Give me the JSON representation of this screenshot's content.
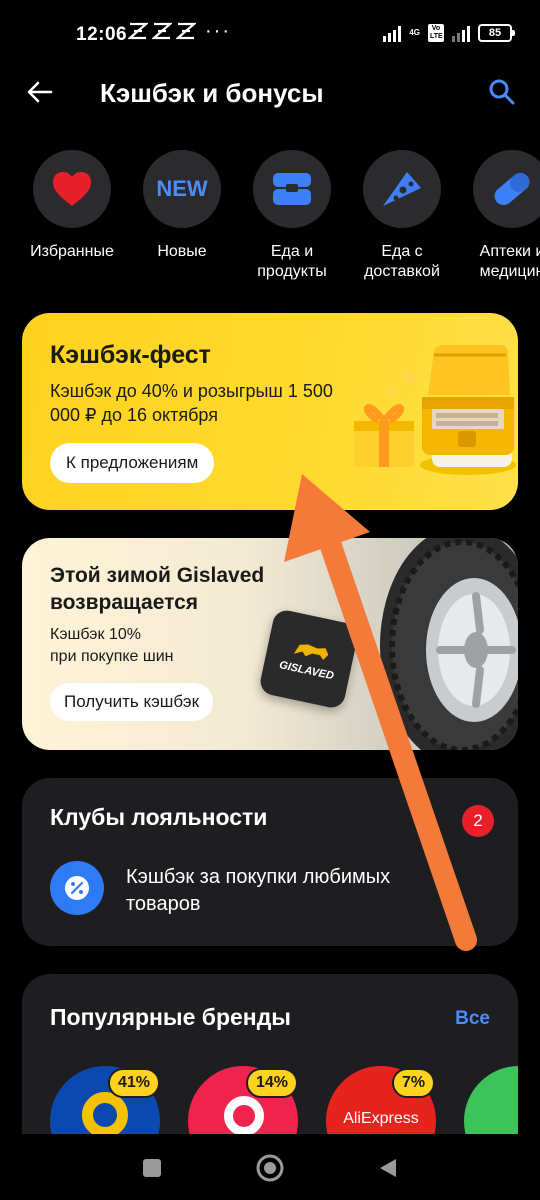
{
  "status": {
    "time": "12:06",
    "network": "4G",
    "volte": "Vo LTE",
    "battery": "85"
  },
  "header": {
    "title": "Кэшбэк и бонусы",
    "back_icon": "arrow-left-icon",
    "search_icon": "search-icon"
  },
  "categories": [
    {
      "label": "Избранные",
      "icon": "heart-icon",
      "color": "#e8202a"
    },
    {
      "label": "Новые",
      "icon": "new-icon",
      "badge_text": "NEW",
      "color": "#4a8cff"
    },
    {
      "label": "Еда и\nпродукты",
      "icon": "food-box-icon",
      "color": "#3d7ff7"
    },
    {
      "label": "Еда с\nдоставкой",
      "icon": "pizza-icon",
      "color": "#3d7ff7"
    },
    {
      "label": "Аптеки и\nмедицин",
      "icon": "pill-icon",
      "color": "#3d7ff7"
    }
  ],
  "promo_fest": {
    "title": "Кэшбэк-фест",
    "subtitle": "Кэшбэк до 40% и розыгрыш 1 500 000 ₽ до 16 октября",
    "button": "К предложениям",
    "bg_color": "#ffd21f"
  },
  "promo_tire": {
    "title": "Этой зимой Gislaved\nвозвращается",
    "subtitle": "Кэшбэк 10%\nпри покупке шин",
    "button": "Получить кэшбэк",
    "logo_text": "GISLAVED"
  },
  "loyalty": {
    "title": "Клубы лояльности",
    "badge": "2",
    "item_text": "Кэшбэк за покупки любимых\nтоваров",
    "badge_color": "#e8202a"
  },
  "brands": {
    "title": "Популярные бренды",
    "all_label": "Все",
    "items": [
      {
        "percent": "41%",
        "color": "#0b49b0"
      },
      {
        "percent": "14%",
        "color": "#f0234e"
      },
      {
        "percent": "7%",
        "color": "#e7231e",
        "name": "AliExpress"
      },
      {
        "percent": "",
        "color": "#3cc45a"
      }
    ]
  },
  "annotation": {
    "arrow_color": "#f47a3a"
  }
}
